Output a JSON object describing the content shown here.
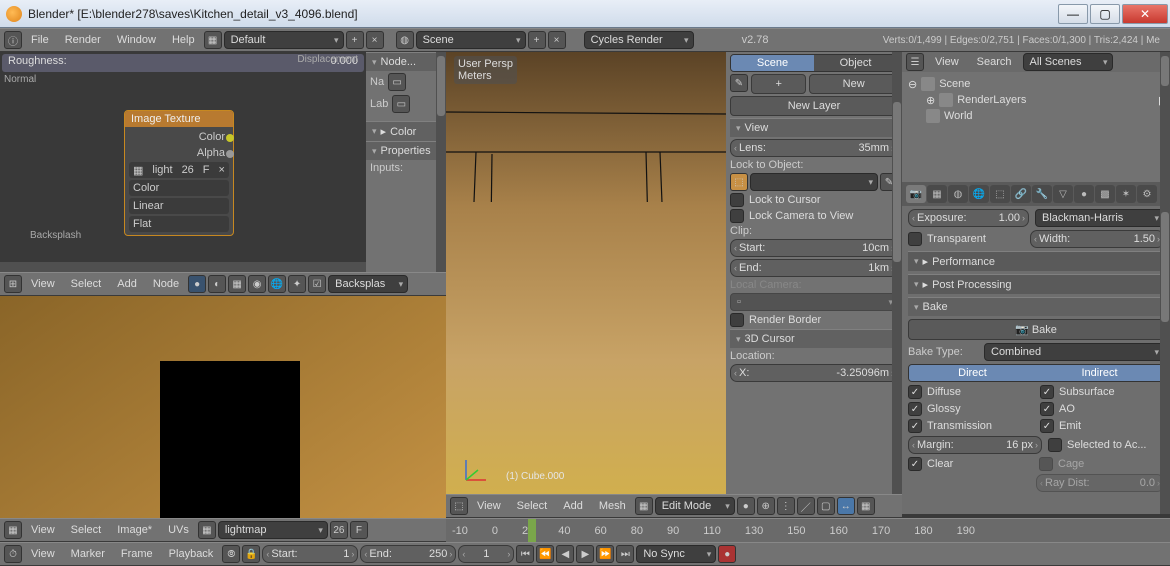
{
  "window": {
    "title": "Blender* [E:\\blender278\\saves\\Kitchen_detail_v3_4096.blend]"
  },
  "info_bar": {
    "menus": [
      "File",
      "Render",
      "Window",
      "Help"
    ],
    "layout_dropdown": "Default",
    "scene_dropdown": "Scene",
    "engine_dropdown": "Cycles Render",
    "version": "v2.78",
    "stats": "Verts:0/1,499 | Edges:0/2,751 | Faces:0/1,300 | Tris:2,424 | Me"
  },
  "node_editor": {
    "roughness": {
      "label": "Roughness:",
      "value": "0.000"
    },
    "normal_label": "Normal",
    "displacement_label": "Displacement",
    "backsplash_label": "Backsplash",
    "image_texture_node": {
      "title": "Image Texture",
      "out_color": "Color",
      "out_alpha": "Alpha",
      "image_field": "light",
      "image_users": "26",
      "image_fake": "F",
      "color_space": "Color",
      "interpolation": "Linear",
      "projection": "Flat"
    },
    "header": {
      "menus": [
        "View",
        "Select",
        "Add",
        "Node"
      ],
      "material": "Backsplas"
    },
    "side": {
      "node_head": "Node...",
      "na_label": "Na",
      "lab_label": "Lab",
      "color_head": "Color",
      "properties_head": "Properties",
      "inputs_label": "Inputs:"
    }
  },
  "uv_editor": {
    "header": {
      "menus": [
        "View",
        "Select",
        "Image*",
        "UVs"
      ],
      "image_dropdown": "lightmap",
      "image_users": "26",
      "fake": "F"
    }
  },
  "viewport": {
    "overlay_label_1": "User Persp",
    "overlay_label_2": "Meters",
    "object_label": "(1) Cube.000",
    "header": {
      "menus": [
        "View",
        "Select",
        "Add",
        "Mesh"
      ],
      "mode": "Edit Mode"
    }
  },
  "n_panel": {
    "scene_btn": "Scene",
    "object_btn": "Object",
    "new_btn": "New",
    "new_layer_btn": "New Layer",
    "view_head": "View",
    "lens": {
      "label": "Lens:",
      "value": "35mm"
    },
    "lock_to_object": "Lock to Object:",
    "lock_to_cursor": "Lock to Cursor",
    "lock_camera": "Lock Camera to View",
    "clip_label": "Clip:",
    "clip_start": {
      "label": "Start:",
      "value": "10cm"
    },
    "clip_end": {
      "label": "End:",
      "value": "1km"
    },
    "local_camera": "Local Camera:",
    "render_border": "Render Border",
    "cursor_head": "3D Cursor",
    "location_label": "Location:",
    "cursor_x": {
      "label": "X:",
      "value": "-3.25096m"
    }
  },
  "outliner": {
    "menus": [
      "View",
      "Search"
    ],
    "filter": "All Scenes",
    "tree": {
      "scene": "Scene",
      "renderlayers": "RenderLayers",
      "world": "World"
    }
  },
  "properties": {
    "exposure": {
      "label": "Exposure:",
      "value": "1.00"
    },
    "pixel_filter": "Blackman-Harris",
    "width": {
      "label": "Width:",
      "value": "1.50"
    },
    "transparent": "Transparent",
    "performance_head": "Performance",
    "post_head": "Post Processing",
    "bake_head": "Bake",
    "bake_btn": "Bake",
    "bake_type_label": "Bake Type:",
    "bake_type": "Combined",
    "direct": "Direct",
    "indirect": "Indirect",
    "passes": {
      "diffuse": "Diffuse",
      "glossy": "Glossy",
      "transmission": "Transmission",
      "subsurface": "Subsurface",
      "ao": "AO",
      "emit": "Emit"
    },
    "margin": {
      "label": "Margin:",
      "value": "16 px"
    },
    "selected_to_active": "Selected to Ac...",
    "clear": "Clear",
    "cage": "Cage",
    "ray_dist": {
      "label": "Ray Dist:",
      "value": "0.0"
    }
  },
  "timeline": {
    "ticks": [
      "-10",
      "0",
      "20",
      "40",
      "60",
      "80",
      "90",
      "110",
      "130",
      "150",
      "160",
      "170",
      "180",
      "190"
    ],
    "header": {
      "menus": [
        "View",
        "Marker",
        "Frame",
        "Playback"
      ],
      "start": {
        "label": "Start:",
        "value": "1"
      },
      "end": {
        "label": "End:",
        "value": "250"
      },
      "current": "1",
      "sync": "No Sync"
    }
  }
}
